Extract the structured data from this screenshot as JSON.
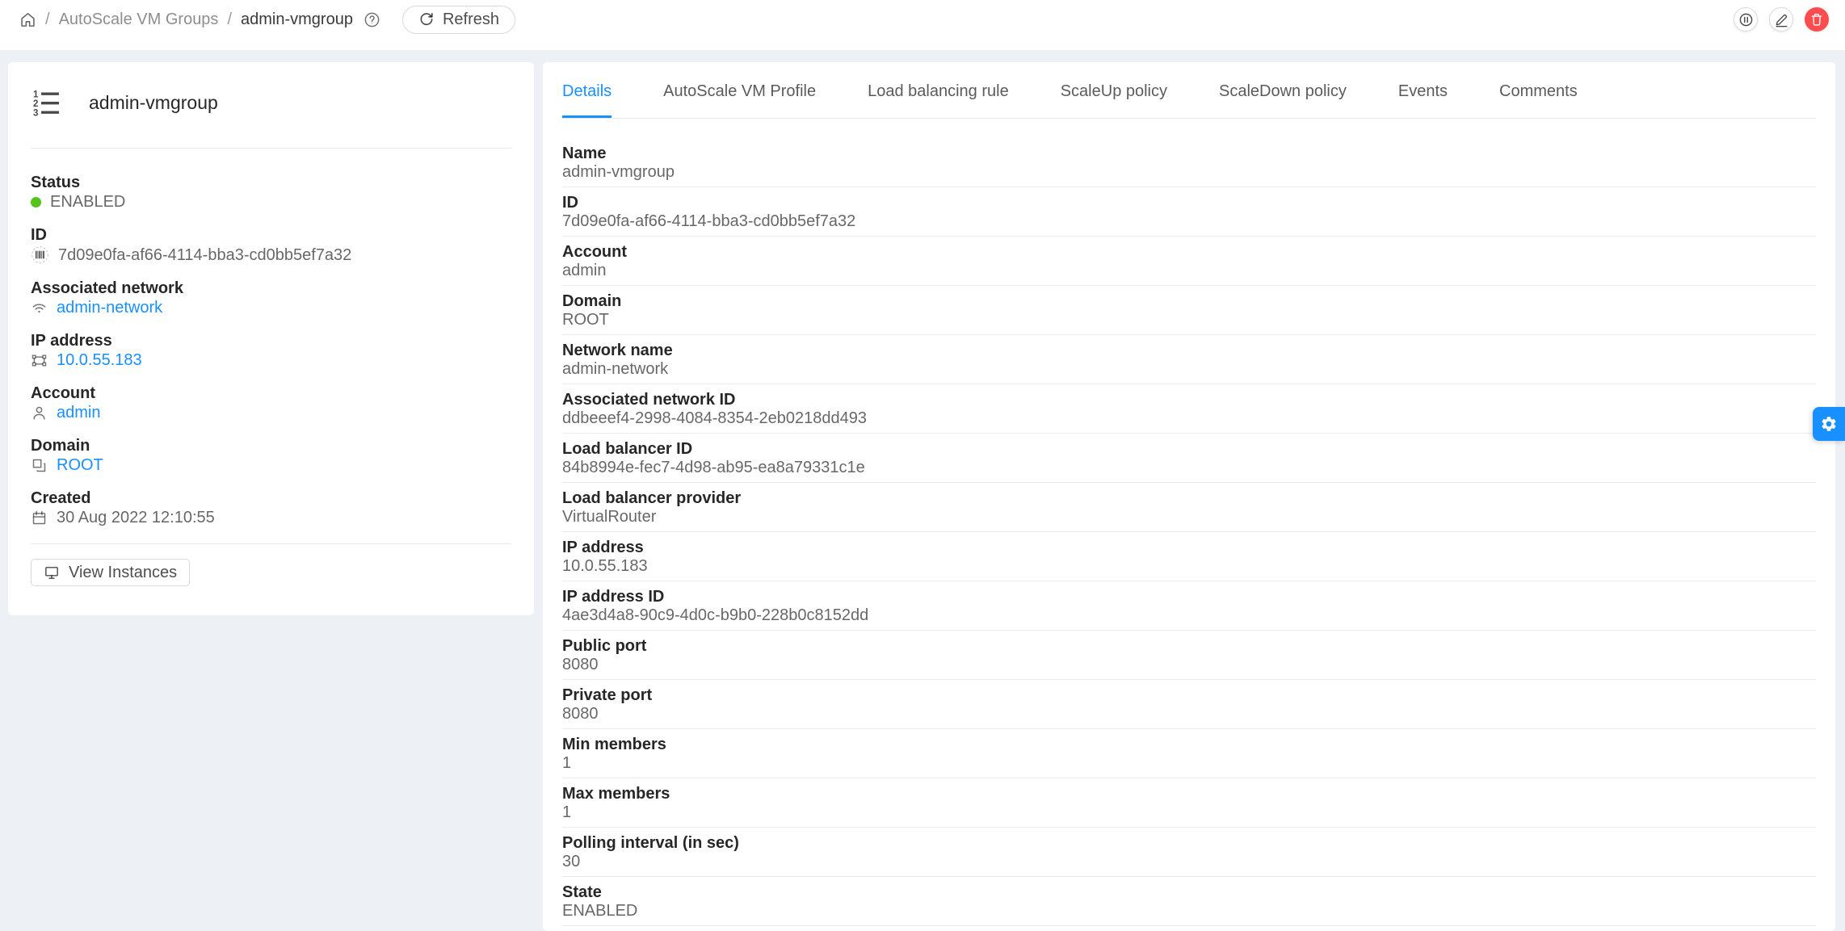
{
  "colors": {
    "primary": "#1890ff",
    "success": "#52c41a",
    "danger": "#ff4d4f"
  },
  "header": {
    "breadcrumb": {
      "section": "AutoScale VM Groups",
      "current": "admin-vmgroup"
    },
    "refresh_label": "Refresh"
  },
  "icons": [
    "home-icon",
    "question-circle-icon",
    "reload-icon",
    "pause-circle-icon",
    "edit-icon",
    "trash-icon",
    "ordered-list-icon",
    "barcode-icon",
    "wifi-icon",
    "ip-frame-icon",
    "user-icon",
    "domain-block-icon",
    "calendar-icon",
    "desktop-icon",
    "gear-icon"
  ],
  "resource": {
    "title": "admin-vmgroup",
    "status_label": "Status",
    "status_value": "ENABLED",
    "id_label": "ID",
    "id_value": "7d09e0fa-af66-4114-bba3-cd0bb5ef7a32",
    "network_label": "Associated network",
    "network_value": "admin-network",
    "ip_label": "IP address",
    "ip_value": "10.0.55.183",
    "account_label": "Account",
    "account_value": "admin",
    "domain_label": "Domain",
    "domain_value": "ROOT",
    "created_label": "Created",
    "created_value": "30 Aug 2022 12:10:55",
    "view_instances_label": "View Instances"
  },
  "tabs": [
    {
      "label": "Details",
      "active": true
    },
    {
      "label": "AutoScale VM Profile",
      "active": false
    },
    {
      "label": "Load balancing rule",
      "active": false
    },
    {
      "label": "ScaleUp policy",
      "active": false
    },
    {
      "label": "ScaleDown policy",
      "active": false
    },
    {
      "label": "Events",
      "active": false
    },
    {
      "label": "Comments",
      "active": false
    }
  ],
  "details": [
    {
      "label": "Name",
      "value": "admin-vmgroup"
    },
    {
      "label": "ID",
      "value": "7d09e0fa-af66-4114-bba3-cd0bb5ef7a32"
    },
    {
      "label": "Account",
      "value": "admin"
    },
    {
      "label": "Domain",
      "value": "ROOT"
    },
    {
      "label": "Network name",
      "value": "admin-network"
    },
    {
      "label": "Associated network ID",
      "value": "ddbeeef4-2998-4084-8354-2eb0218dd493"
    },
    {
      "label": "Load balancer ID",
      "value": "84b8994e-fec7-4d98-ab95-ea8a79331c1e"
    },
    {
      "label": "Load balancer provider",
      "value": "VirtualRouter"
    },
    {
      "label": "IP address",
      "value": "10.0.55.183"
    },
    {
      "label": "IP address ID",
      "value": "4ae3d4a8-90c9-4d0c-b9b0-228b0c8152dd"
    },
    {
      "label": "Public port",
      "value": "8080"
    },
    {
      "label": "Private port",
      "value": "8080"
    },
    {
      "label": "Min members",
      "value": "1"
    },
    {
      "label": "Max members",
      "value": "1"
    },
    {
      "label": "Polling interval (in sec)",
      "value": "30"
    },
    {
      "label": "State",
      "value": "ENABLED"
    }
  ]
}
